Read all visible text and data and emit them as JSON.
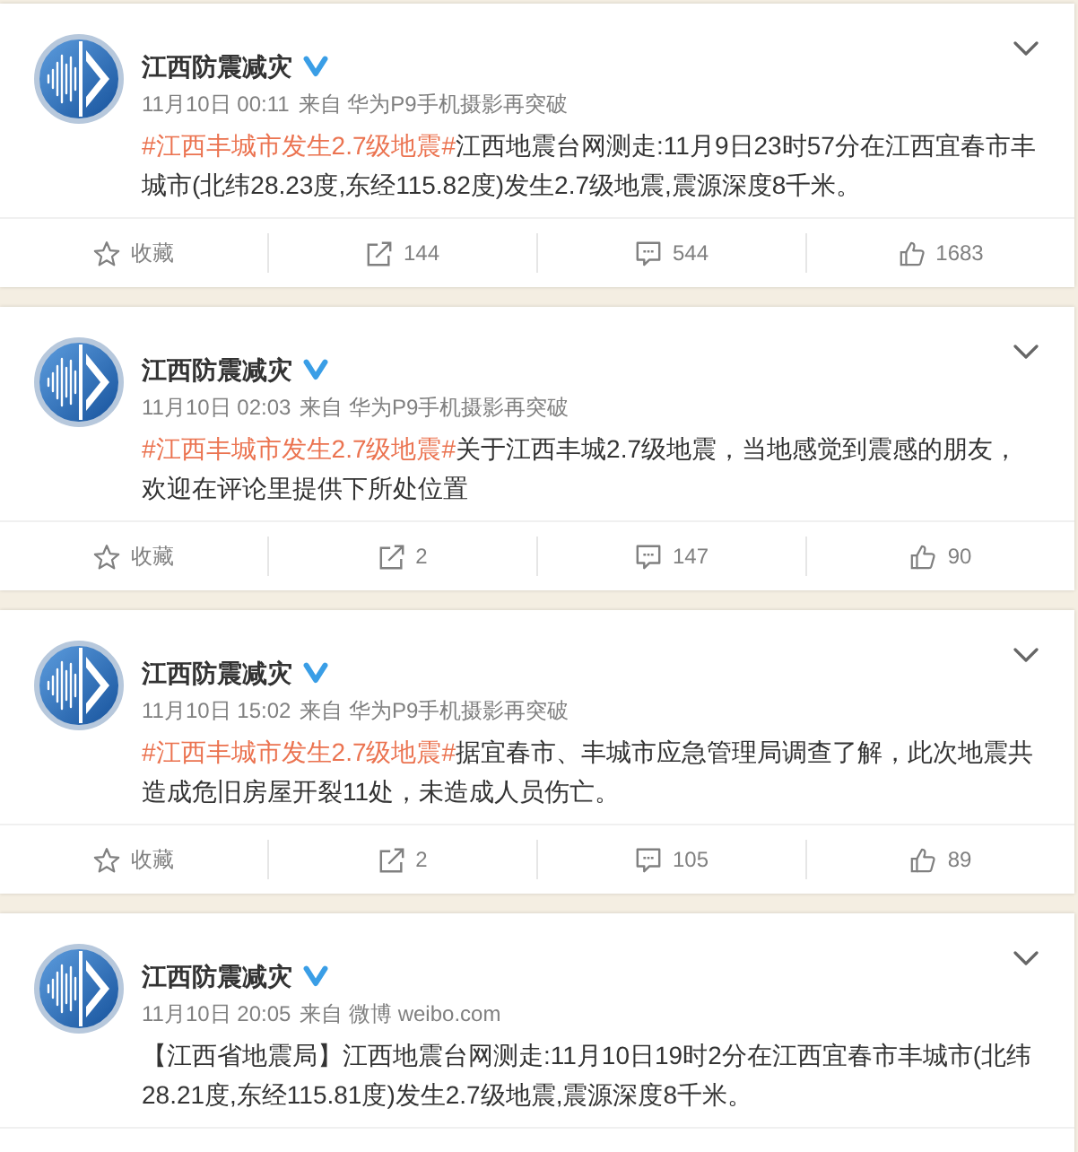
{
  "posts": [
    {
      "author": "江西防震减灾",
      "verified": true,
      "time": "11月10日 00:11",
      "source": "来自 华为P9手机摄影再突破",
      "topic": "#江西丰城市发生2.7级地震#",
      "text": "江西地震台网测走:11月9日23时57分在江西宜春市丰城市(北纬28.23度,东经115.82度)发生2.7级地震,震源深度8千米。",
      "actions": [
        {
          "kind": "favorite",
          "label": "收藏"
        },
        {
          "kind": "repost",
          "label": "144"
        },
        {
          "kind": "comment",
          "label": "544"
        },
        {
          "kind": "like",
          "label": "1683"
        }
      ]
    },
    {
      "author": "江西防震减灾",
      "verified": true,
      "time": "11月10日 02:03",
      "source": "来自 华为P9手机摄影再突破",
      "topic": "#江西丰城市发生2.7级地震#",
      "text": "关于江西丰城2.7级地震，当地感觉到震感的朋友，欢迎在评论里提供下所处位置",
      "actions": [
        {
          "kind": "favorite",
          "label": "收藏"
        },
        {
          "kind": "repost",
          "label": "2"
        },
        {
          "kind": "comment",
          "label": "147"
        },
        {
          "kind": "like",
          "label": "90"
        }
      ]
    },
    {
      "author": "江西防震减灾",
      "verified": true,
      "time": "11月10日 15:02",
      "source": "来自 华为P9手机摄影再突破",
      "topic": "#江西丰城市发生2.7级地震#",
      "text": "据宜春市、丰城市应急管理局调查了解，此次地震共造成危旧房屋开裂11处，未造成人员伤亡。",
      "actions": [
        {
          "kind": "favorite",
          "label": "收藏"
        },
        {
          "kind": "repost",
          "label": "2"
        },
        {
          "kind": "comment",
          "label": "105"
        },
        {
          "kind": "like",
          "label": "89"
        }
      ]
    },
    {
      "author": "江西防震减灾",
      "verified": true,
      "time": "11月10日 20:05",
      "source": "来自 微博 weibo.com",
      "text": "【江西省地震局】江西地震台网测走:11月10日19时2分在江西宜春市丰城市(北纬28.21度,东经115.81度)发生2.7级地震,震源深度8千米。"
    }
  ]
}
